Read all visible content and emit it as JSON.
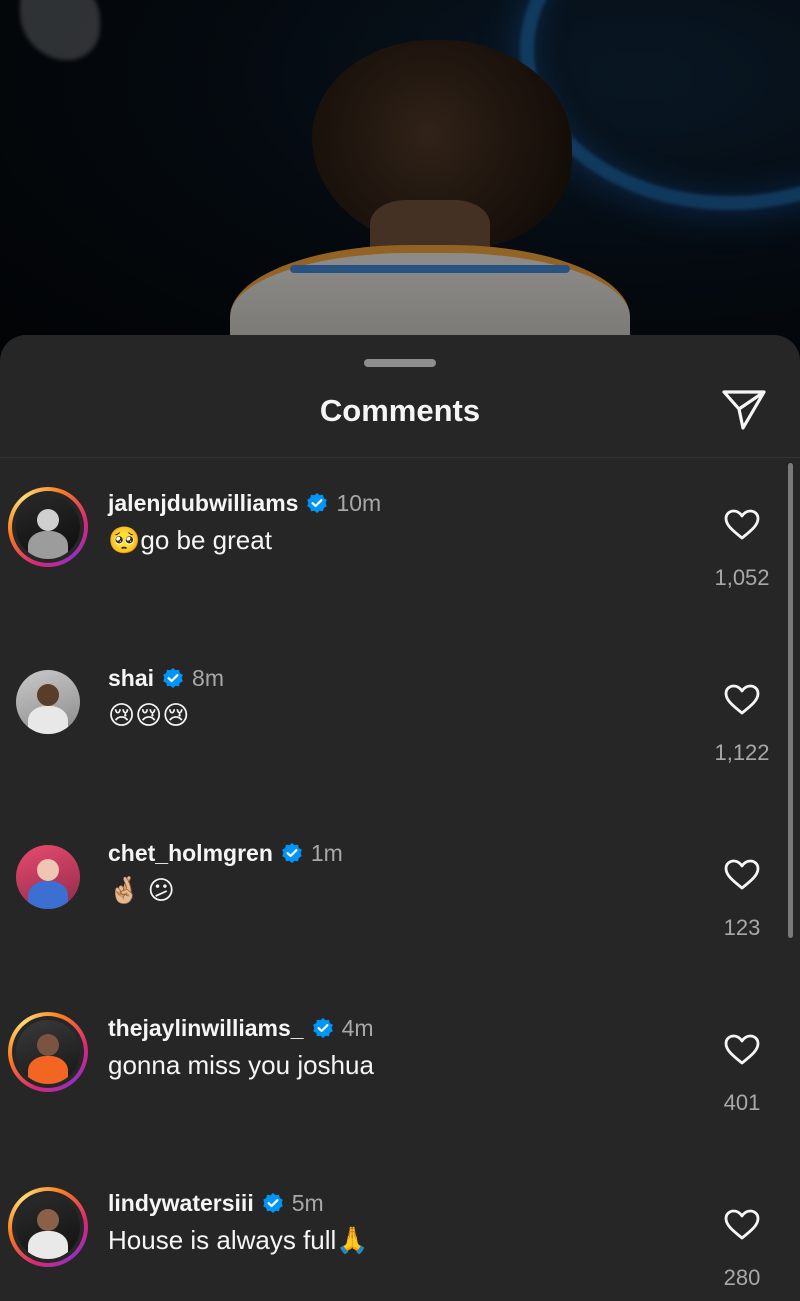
{
  "sheet": {
    "title": "Comments"
  },
  "icons": {
    "share": "paper-plane-icon",
    "like": "heart-outline-icon",
    "verified": "verified-badge-icon"
  },
  "colors": {
    "sheet_bg": "#262626",
    "verified_blue": "#0095f6",
    "muted_text": "#a8a8a8"
  },
  "comments": [
    {
      "username": "jalenjdubwilliams",
      "verified": true,
      "time": "10m",
      "text": "🥺go be great",
      "likes": "1,052",
      "story_ring": true
    },
    {
      "username": "shai",
      "verified": true,
      "time": "8m",
      "text": "😢😢😢",
      "likes": "1,122",
      "story_ring": false
    },
    {
      "username": "chet_holmgren",
      "verified": true,
      "time": "1m",
      "text": "🤞🏼 😕",
      "likes": "123",
      "story_ring": false
    },
    {
      "username": "thejaylinwilliams_",
      "verified": true,
      "time": "4m",
      "text": "gonna miss you joshua",
      "likes": "401",
      "story_ring": true
    },
    {
      "username": "lindywatersiii",
      "verified": true,
      "time": "5m",
      "text": "House is always full🙏",
      "likes": "280",
      "story_ring": true
    }
  ]
}
